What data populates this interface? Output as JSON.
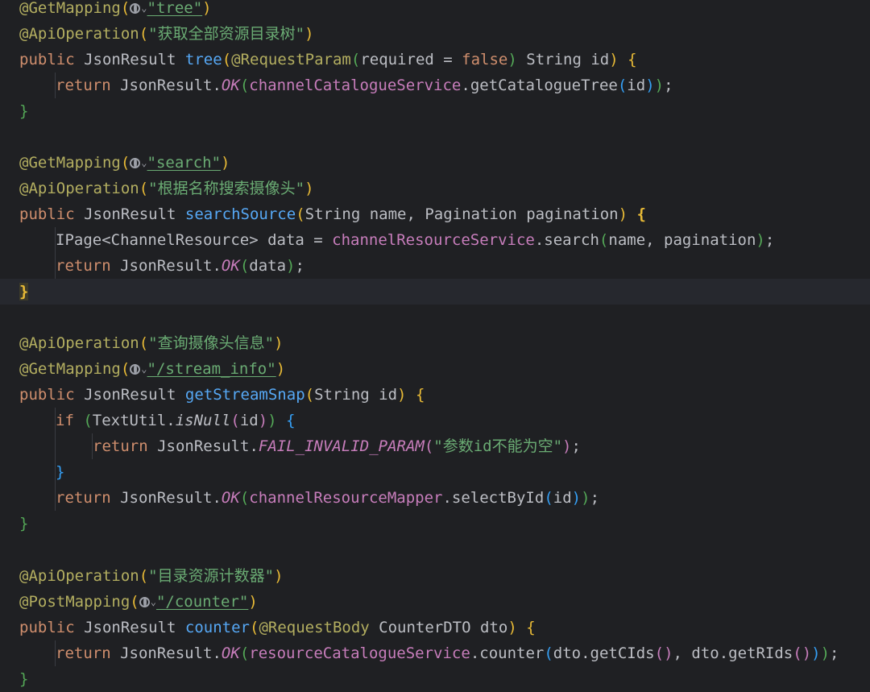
{
  "editor": {
    "blocks": {
      "tree": {
        "ann_get": "@GetMapping",
        "path": "\"tree\"",
        "ann_api": "@ApiOperation",
        "desc": "\"获取全部资源目录树\"",
        "sig_kw": "public ",
        "sig_type": "JsonResult ",
        "sig_name": "tree",
        "param_ann": "@RequestParam",
        "param_rest_a": "required = ",
        "param_false": "false",
        "param_rest_b": " String id",
        "ret": "return ",
        "body_a": "JsonResult.",
        "ok": "OK",
        "field": "channelCatalogueService",
        "call": ".getCatalogueTree",
        "args": "id"
      },
      "search": {
        "ann_get": "@GetMapping",
        "path": "\"search\"",
        "ann_api": "@ApiOperation",
        "desc": "\"根据名称搜索摄像头\"",
        "sig_kw": "public ",
        "sig_type": "JsonResult ",
        "sig_name": "searchSource",
        "params": "String name, Pagination pagination",
        "decl": "IPage<ChannelResource> data = ",
        "field": "channelResourceService",
        "call": ".search",
        "args": "name, pagination",
        "ret": "return ",
        "body_a": "JsonResult.",
        "ok": "OK",
        "ret_args": "data"
      },
      "stream": {
        "ann_api": "@ApiOperation",
        "desc": "\"查询摄像头信息\"",
        "ann_get": "@GetMapping",
        "path": "\"/stream_info\"",
        "sig_kw": "public ",
        "sig_type": "JsonResult ",
        "sig_name": "getStreamSnap",
        "params": "String id",
        "if_kw": "if ",
        "cond_a": "TextUtil.",
        "cond_fn": "isNull",
        "cond_args": "id",
        "ret": "return ",
        "body_a": "JsonResult.",
        "fail": "FAIL_INVALID_PARAM",
        "fail_msg": "\"参数id不能为空\"",
        "ok": "OK",
        "field": "channelResourceMapper",
        "call": ".selectById",
        "args": "id"
      },
      "counter": {
        "ann_api": "@ApiOperation",
        "desc": "\"目录资源计数器\"",
        "ann_post": "@PostMapping",
        "path": "\"/counter\"",
        "sig_kw": "public ",
        "sig_type": "JsonResult ",
        "sig_name": "counter",
        "param_ann": "@RequestBody",
        "params": " CounterDTO dto",
        "ret": "return ",
        "body_a": "JsonResult.",
        "ok": "OK",
        "field": "resourceCatalogueService",
        "call": ".counter",
        "args_a": "dto.getCIds",
        "args_b": "dto.getRIds"
      }
    }
  }
}
